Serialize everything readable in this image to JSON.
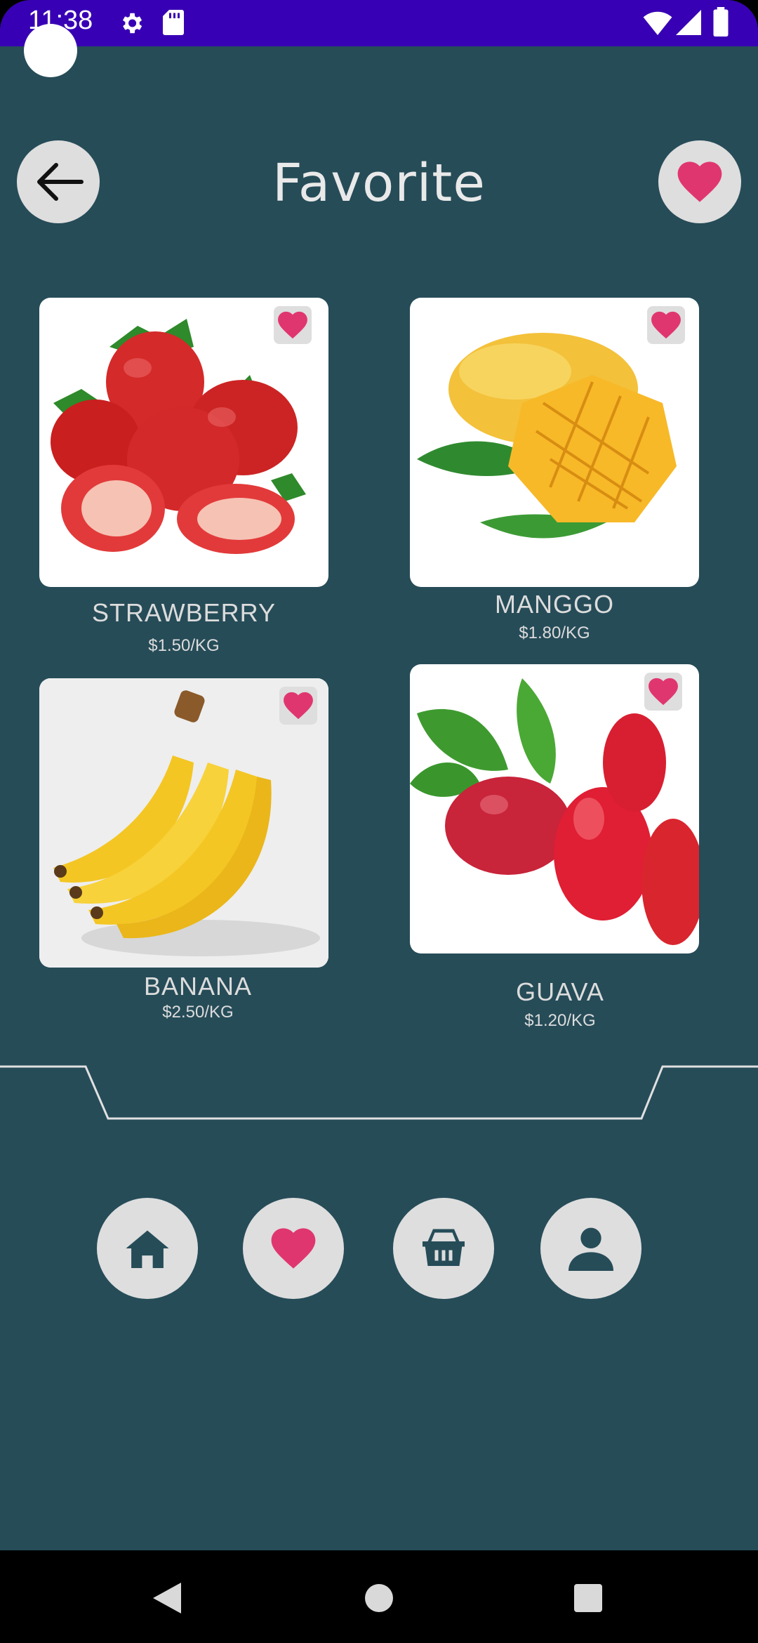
{
  "status_bar": {
    "time": "11:38"
  },
  "header": {
    "title": "Favorite"
  },
  "products": [
    {
      "name": "STRAWBERRY",
      "price": "$1.50/KG",
      "favorite": true
    },
    {
      "name": "MANGGO",
      "price": "$1.80/KG",
      "favorite": true
    },
    {
      "name": "BANANA",
      "price": "$2.50/KG",
      "favorite": true
    },
    {
      "name": "GUAVA",
      "price": "$1.20/KG",
      "favorite": true
    }
  ],
  "bottom_nav": {
    "items": [
      {
        "icon": "home-icon"
      },
      {
        "icon": "heart-icon",
        "active": true
      },
      {
        "icon": "basket-icon"
      },
      {
        "icon": "user-icon"
      }
    ]
  },
  "colors": {
    "background": "#264c58",
    "status_bar": "#3800b4",
    "accent_heart": "#e0366f",
    "button_bg": "#dedede"
  }
}
